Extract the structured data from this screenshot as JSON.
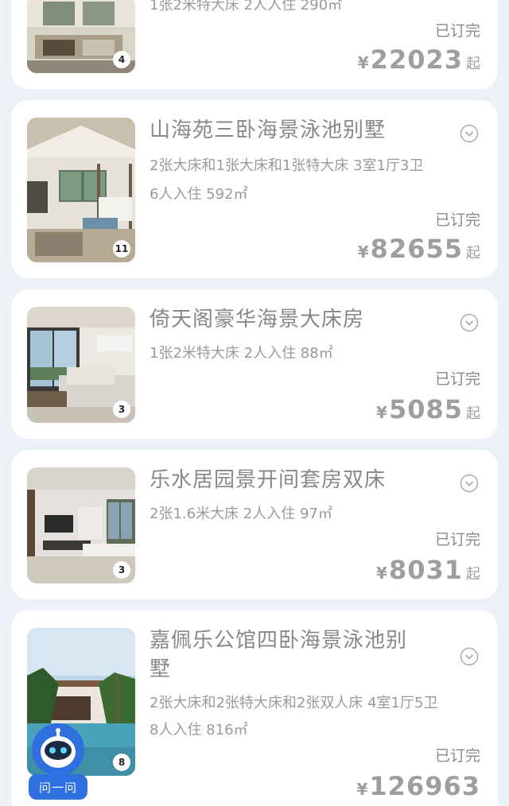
{
  "currency_symbol": "¥",
  "price_suffix": "起",
  "status_booked": "已订完",
  "unit_sqm": "㎡",
  "rooms": [
    {
      "title": "",
      "line1": "1张2米特大床  2人入住  290㎡",
      "line2": "",
      "photo_count": "4",
      "status": "已订完",
      "price": "22023"
    },
    {
      "title": "山海苑三卧海景泳池别墅",
      "line1": "2张大床和1张大床和1张特大床  3室1厅3卫",
      "line2": "6人入住  592㎡",
      "photo_count": "11",
      "status": "已订完",
      "price": "82655"
    },
    {
      "title": "倚天阁豪华海景大床房",
      "line1": "1张2米特大床  2人入住  88㎡",
      "line2": "",
      "photo_count": "3",
      "status": "已订完",
      "price": "5085"
    },
    {
      "title": "乐水居园景开间套房双床",
      "line1": "2张1.6米大床  2人入住  97㎡",
      "line2": "",
      "photo_count": "3",
      "status": "已订完",
      "price": "8031"
    },
    {
      "title": "嘉佩乐公馆四卧海景泳池别墅",
      "line1": "2张大床和2张特大床和2张双人床  4室1厅5卫",
      "line2": "8人入住  816㎡",
      "photo_count": "8",
      "status": "已订完",
      "price": "126963"
    }
  ],
  "assistant": {
    "label": "问一问",
    "icon": "robot-assistant-icon",
    "color": "#2f6fe0"
  },
  "colors": {
    "background": "#eef0f7",
    "card": "#ffffff",
    "text_gray": "#8a8a8a"
  }
}
